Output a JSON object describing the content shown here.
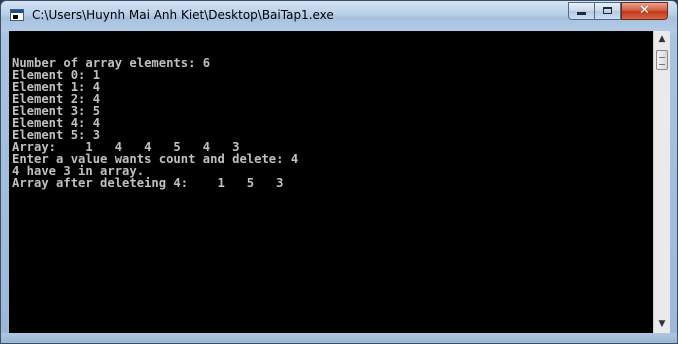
{
  "window": {
    "title": "C:\\Users\\Huynh Mai Anh Kiet\\Desktop\\BaiTap1.exe"
  },
  "controls": {
    "close_glyph": "✕"
  },
  "scrollbar": {
    "up_glyph": "▲",
    "down_glyph": "▼"
  },
  "console": {
    "lines": [
      "Number of array elements: 6",
      "Element 0: 1",
      "Element 1: 4",
      "Element 2: 4",
      "Element 3: 5",
      "Element 4: 4",
      "Element 5: 3",
      "Array:    1   4   4   5   4   3",
      "Enter a value wants count and delete: 4",
      "4 have 3 in array.",
      "Array after deleteing 4:    1   5   3"
    ]
  }
}
